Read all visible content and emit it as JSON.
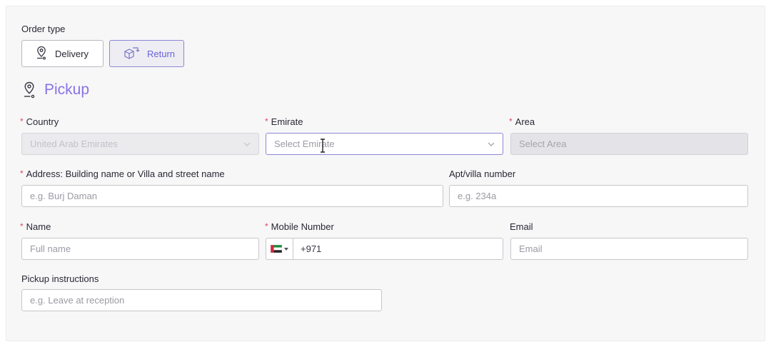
{
  "order_type": {
    "label": "Order type",
    "options": [
      {
        "label": "Delivery",
        "icon": "location-pin-icon",
        "selected": false
      },
      {
        "label": "Return",
        "icon": "box-return-icon",
        "selected": true
      }
    ]
  },
  "section": {
    "title": "Pickup",
    "icon": "location-pin-icon"
  },
  "required_marker": "*",
  "fields": {
    "country": {
      "label": "Country",
      "value": "United Arab Emirates",
      "required": true
    },
    "emirate": {
      "label": "Emirate",
      "placeholder": "Select Emirate",
      "required": true
    },
    "area": {
      "label": "Area",
      "placeholder": "Select Area",
      "required": true
    },
    "address": {
      "label": "Address: Building name or Villa and street name",
      "placeholder": "e.g. Burj Daman",
      "required": true
    },
    "apt": {
      "label": "Apt/villa number",
      "placeholder": "e.g. 234a",
      "required": false
    },
    "name": {
      "label": "Name",
      "placeholder": "Full name",
      "required": true
    },
    "mobile": {
      "label": "Mobile Number",
      "prefix": "+971",
      "country_flag": "uae-flag-icon",
      "required": true
    },
    "email": {
      "label": "Email",
      "placeholder": "Email",
      "required": false
    },
    "instructions": {
      "label": "Pickup instructions",
      "placeholder": "e.g. Leave at reception",
      "required": false
    }
  },
  "colors": {
    "accent": "#8a72e6",
    "required": "#e0475c",
    "active_border": "#8c87d6"
  }
}
